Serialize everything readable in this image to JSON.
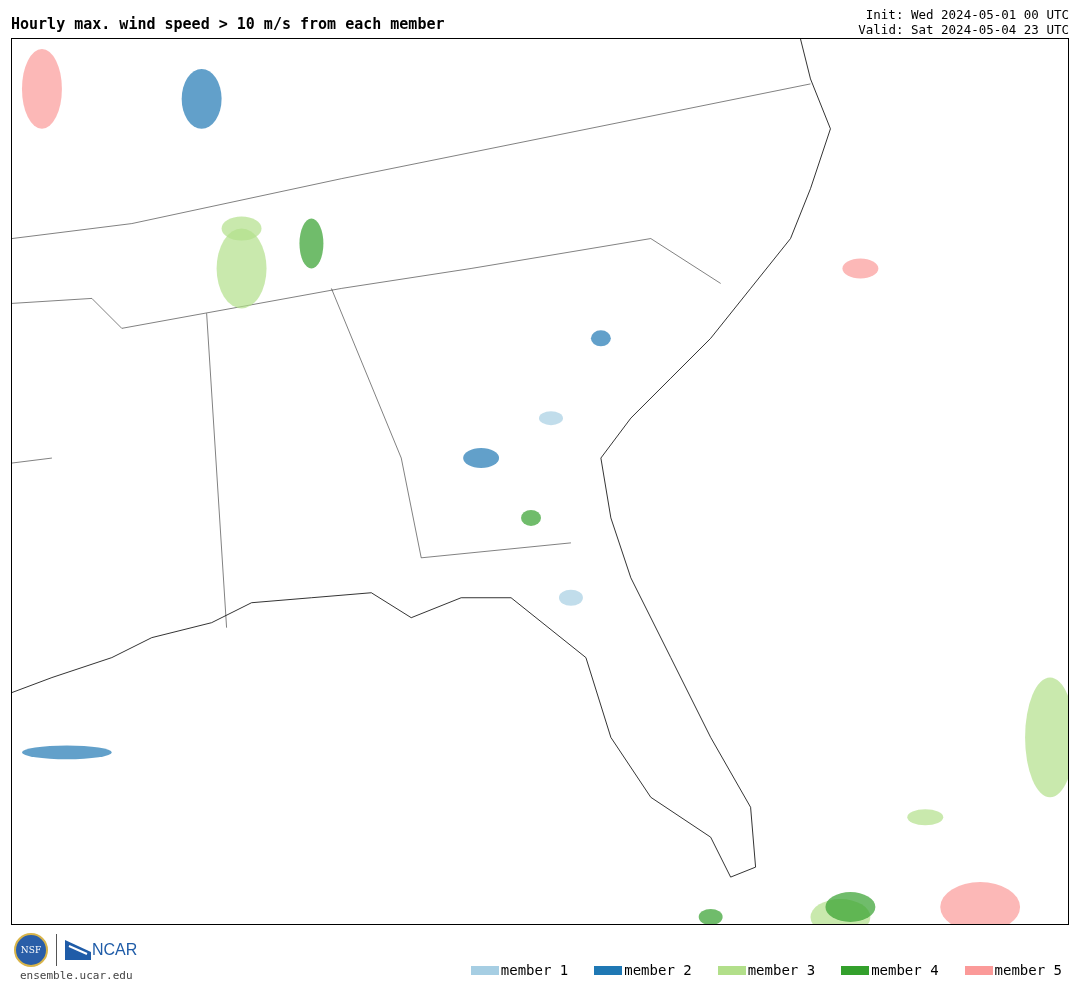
{
  "title": "Hourly max. wind speed > 10 m/s from each member",
  "init": "Init: Wed 2024-05-01 00 UTC",
  "valid": "Valid: Sat 2024-05-04 23 UTC",
  "logos": {
    "nsf": "NSF",
    "ncar": "NCAR"
  },
  "site": "ensemble.ucar.edu",
  "legend": [
    {
      "label": "member 1",
      "color": "#a6cee3"
    },
    {
      "label": "member 2",
      "color": "#1f78b4"
    },
    {
      "label": "member 3",
      "color": "#b2df8a"
    },
    {
      "label": "member 4",
      "color": "#33a02c"
    },
    {
      "label": "member 5",
      "color": "#fb9a99"
    }
  ]
}
